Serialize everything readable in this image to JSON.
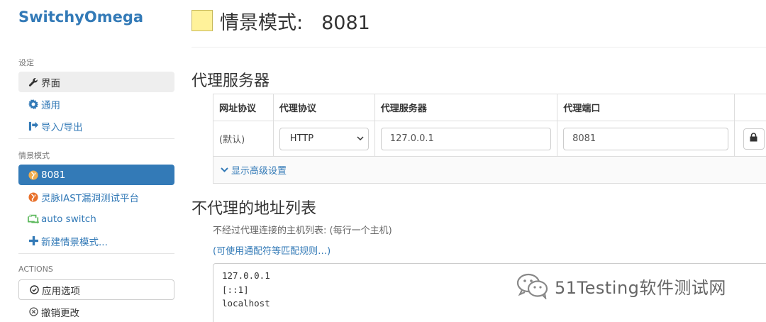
{
  "sidebar": {
    "title": "SwitchyOmega",
    "sections": {
      "settings": "设定",
      "profiles": "情景模式",
      "actions": "ACTIONS"
    },
    "settings_items": [
      {
        "label": "界面",
        "icon": "wrench-icon"
      },
      {
        "label": "通用",
        "icon": "gear-icon"
      },
      {
        "label": "导入/导出",
        "icon": "import-export-icon"
      }
    ],
    "profile_items": [
      {
        "label": "8081",
        "icon": "globe-icon"
      },
      {
        "label": "灵脉IAST漏洞测试平台",
        "icon": "globe-icon"
      },
      {
        "label": "auto switch",
        "icon": "retweet-icon"
      },
      {
        "label": "新建情景模式...",
        "icon": "plus-icon"
      }
    ],
    "action_items": [
      {
        "label": "应用选项",
        "icon": "check-circle-icon"
      },
      {
        "label": "撤销更改",
        "icon": "x-circle-icon"
      }
    ]
  },
  "header": {
    "title": "情景模式:",
    "profile_name": "8081",
    "swatch_color": "#fff29a"
  },
  "proxy_section": {
    "heading": "代理服务器",
    "columns": [
      "网址协议",
      "代理协议",
      "代理服务器",
      "代理端口"
    ],
    "row": {
      "scheme": "(默认)",
      "protocol": "HTTP",
      "server": "127.0.0.1",
      "port": "8081"
    },
    "advanced_link": "显示高级设置"
  },
  "bypass_section": {
    "heading": "不代理的地址列表",
    "help": "不经过代理连接的主机列表: (每行一个主机)",
    "link": "(可使用通配符等匹配规则…)",
    "entries": [
      "127.0.0.1",
      "[::1]",
      "localhost"
    ]
  },
  "watermark": {
    "text": "51Testing软件测试网"
  },
  "colors": {
    "accent": "#337ab7",
    "active_bg": "#337ab7",
    "profile_8081": "#f0ad4e",
    "profile_iast": "#e8702a",
    "auto_switch": "#5cb85c"
  }
}
